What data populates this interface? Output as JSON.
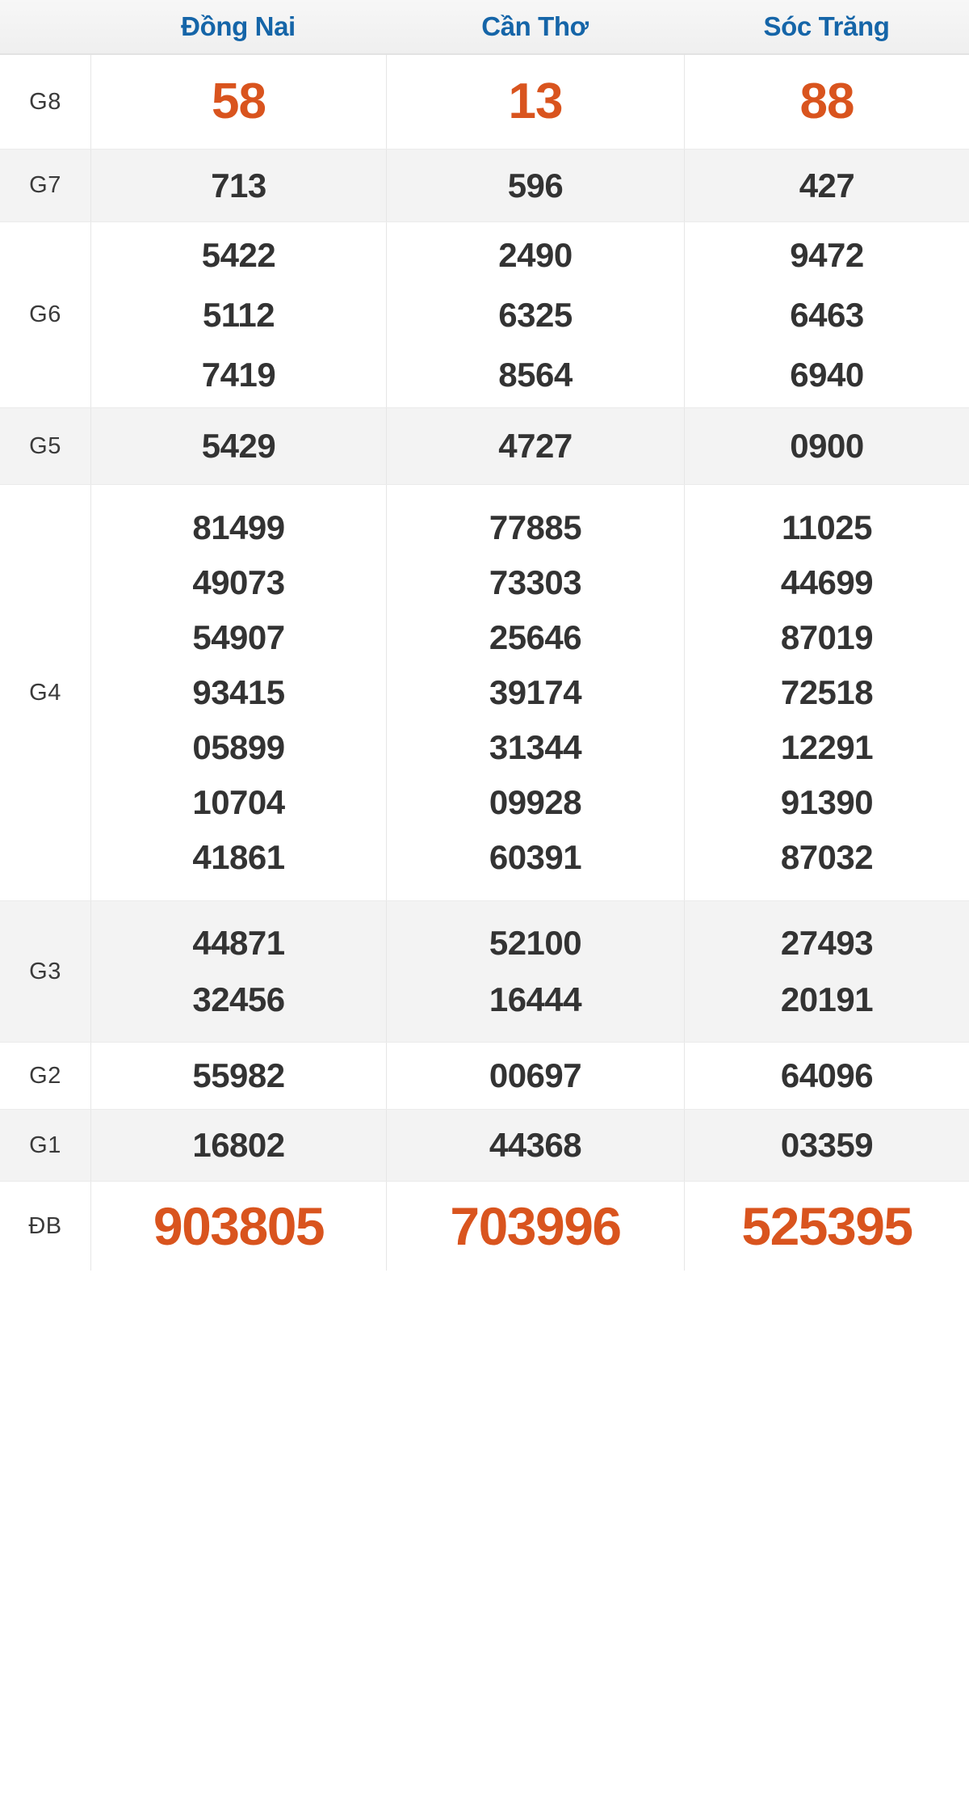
{
  "table": {
    "type": "lottery-results",
    "columns": [
      {
        "id": "dong-nai",
        "label": "Đồng Nai"
      },
      {
        "id": "can-tho",
        "label": "Cần Thơ"
      },
      {
        "id": "soc-trang",
        "label": "Sóc Trăng"
      }
    ],
    "header_color": "#1565a8",
    "highlight_color": "#d9541e",
    "number_color": "#333333",
    "rows": [
      {
        "id": "g8",
        "label": "G8",
        "highlight": true,
        "cells": [
          [
            "58"
          ],
          [
            "13"
          ],
          [
            "88"
          ]
        ]
      },
      {
        "id": "g7",
        "label": "G7",
        "highlight": false,
        "cells": [
          [
            "713"
          ],
          [
            "596"
          ],
          [
            "427"
          ]
        ]
      },
      {
        "id": "g6",
        "label": "G6",
        "highlight": false,
        "cells": [
          [
            "5422",
            "5112",
            "7419"
          ],
          [
            "2490",
            "6325",
            "8564"
          ],
          [
            "9472",
            "6463",
            "6940"
          ]
        ]
      },
      {
        "id": "g5",
        "label": "G5",
        "highlight": false,
        "cells": [
          [
            "5429"
          ],
          [
            "4727"
          ],
          [
            "0900"
          ]
        ]
      },
      {
        "id": "g4",
        "label": "G4",
        "highlight": false,
        "cells": [
          [
            "81499",
            "49073",
            "54907",
            "93415",
            "05899",
            "10704",
            "41861"
          ],
          [
            "77885",
            "73303",
            "25646",
            "39174",
            "31344",
            "09928",
            "60391"
          ],
          [
            "11025",
            "44699",
            "87019",
            "72518",
            "12291",
            "91390",
            "87032"
          ]
        ]
      },
      {
        "id": "g3",
        "label": "G3",
        "highlight": false,
        "cells": [
          [
            "44871",
            "32456"
          ],
          [
            "52100",
            "16444"
          ],
          [
            "27493",
            "20191"
          ]
        ]
      },
      {
        "id": "g2",
        "label": "G2",
        "highlight": false,
        "cells": [
          [
            "55982"
          ],
          [
            "00697"
          ],
          [
            "64096"
          ]
        ]
      },
      {
        "id": "g1",
        "label": "G1",
        "highlight": false,
        "cells": [
          [
            "16802"
          ],
          [
            "44368"
          ],
          [
            "03359"
          ]
        ]
      },
      {
        "id": "db",
        "label": "ĐB",
        "highlight": true,
        "cells": [
          [
            "903805"
          ],
          [
            "703996"
          ],
          [
            "525395"
          ]
        ]
      }
    ]
  }
}
